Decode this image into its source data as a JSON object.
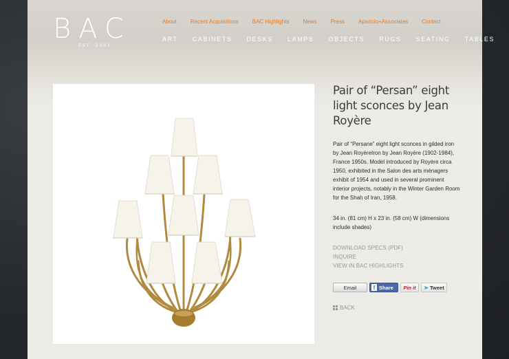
{
  "logo": {
    "text": "BAC",
    "tagline": "EST. 2001"
  },
  "top_links": [
    "About",
    "Recent Acquisitions",
    "BAC Highlights",
    "News",
    "Press",
    "Aparicio+Associates",
    "Contact"
  ],
  "main_nav": [
    "ART",
    "CABINETS",
    "DESKS",
    "LAMPS",
    "OBJECTS",
    "RUGS",
    "SEATING",
    "TABLES"
  ],
  "product": {
    "title": "Pair of “Persan” eight light sconces by Jean Royère",
    "description": "Pair of “Persane” eight light sconces in gilded iron by Jean RoyèreIron by Jean Royère  (1902-1984), France 1950s. Model introduced by Royère circa 1950, exhibited in the Salon des arts ménagers exhibit of 1954 and used in several prominent interior projects, notably in the Winter Garden Room for the Shah of Iran, 1958.",
    "dimensions": "34 in. (81 cm) H x 23 in. (58 cm) W (dimensions include shades)"
  },
  "actions": [
    "DOWNLOAD SPECS (PDF)",
    "INQUIRE",
    "VIEW IN BAC HIGHLIGHTS"
  ],
  "share": {
    "email": "Email",
    "facebook": "Share",
    "pinterest": "Pin it",
    "twitter": "Tweet"
  },
  "back_label": "BACK",
  "colors": {
    "accent": "#e67b23",
    "muted_link": "#9a9894",
    "brass": "#b08a3e",
    "shade": "#f6f3ea"
  }
}
